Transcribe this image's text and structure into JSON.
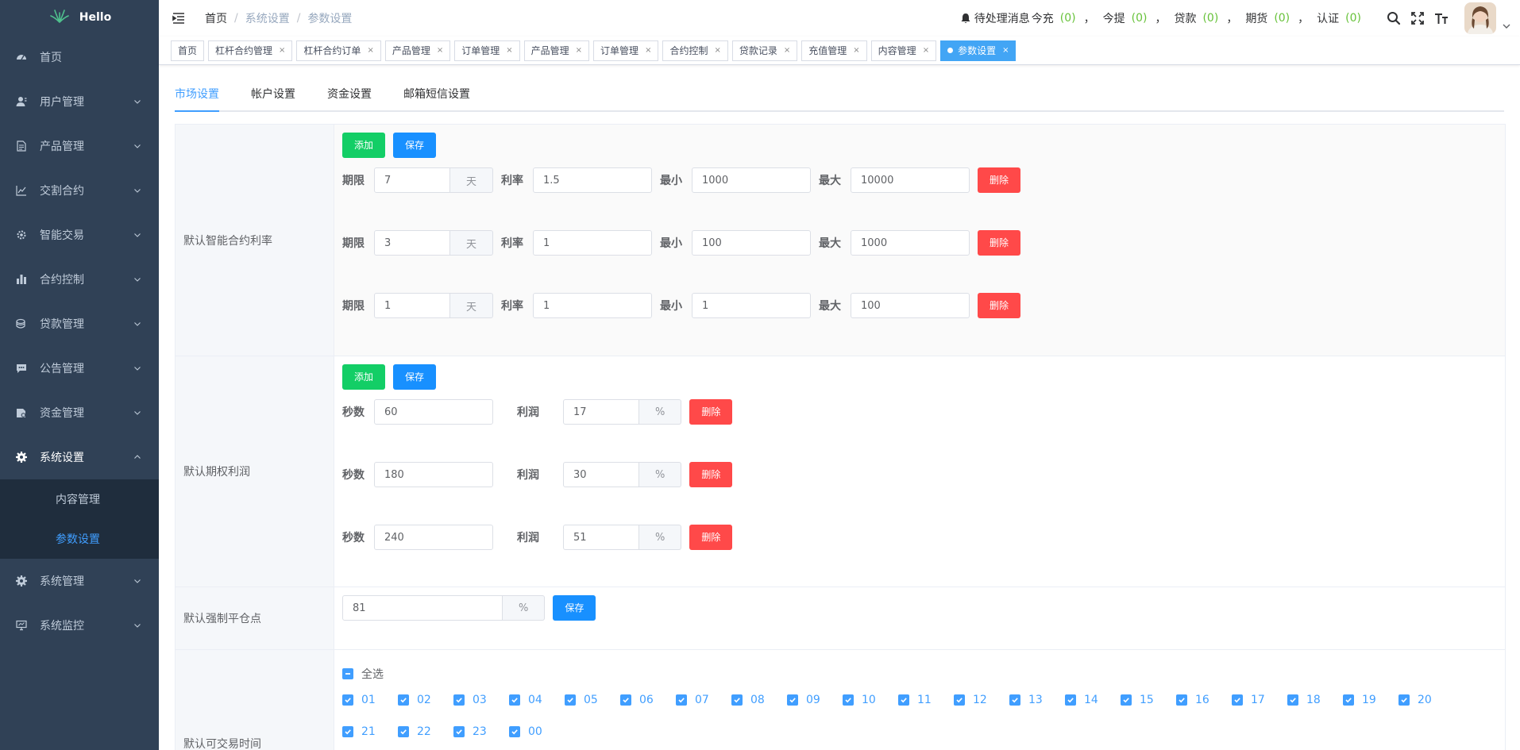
{
  "app": {
    "name": "Hello"
  },
  "sidebar": {
    "items": [
      {
        "label": "首页",
        "icon": "dashboard-icon",
        "has_arrow": false
      },
      {
        "label": "用户管理",
        "icon": "user-icon",
        "has_arrow": true
      },
      {
        "label": "产品管理",
        "icon": "document-icon",
        "has_arrow": true
      },
      {
        "label": "交割合约",
        "icon": "chart-line-icon",
        "has_arrow": true
      },
      {
        "label": "智能交易",
        "icon": "gear-small-icon",
        "has_arrow": true
      },
      {
        "label": "合约控制",
        "icon": "bar-chart-icon",
        "has_arrow": true
      },
      {
        "label": "贷款管理",
        "icon": "money-icon",
        "has_arrow": true
      },
      {
        "label": "公告管理",
        "icon": "message-icon",
        "has_arrow": true
      },
      {
        "label": "资金管理",
        "icon": "wallet-icon",
        "has_arrow": true
      },
      {
        "label": "系统设置",
        "icon": "gear-icon",
        "has_arrow": true,
        "open": true
      },
      {
        "label": "系统管理",
        "icon": "gear-icon",
        "has_arrow": true
      },
      {
        "label": "系统监控",
        "icon": "monitor-icon",
        "has_arrow": true
      }
    ],
    "submenu": [
      {
        "label": "内容管理",
        "active": false
      },
      {
        "label": "参数设置",
        "active": true
      }
    ]
  },
  "header": {
    "breadcrumb": [
      "首页",
      "系统设置",
      "参数设置"
    ],
    "notice_label": "待处理消息",
    "notices": [
      {
        "label": "今充",
        "count": "(0)"
      },
      {
        "label": "今提",
        "count": "(0)"
      },
      {
        "label": "贷款",
        "count": "(0)"
      },
      {
        "label": "期货",
        "count": "(0)"
      },
      {
        "label": "认证",
        "count": "(0)"
      }
    ],
    "comma": "，"
  },
  "tags": [
    {
      "label": "首页",
      "closable": false,
      "active": false
    },
    {
      "label": "杠杆合约管理",
      "closable": true,
      "active": false
    },
    {
      "label": "杠杆合约订单",
      "closable": true,
      "active": false
    },
    {
      "label": "产品管理",
      "closable": true,
      "active": false
    },
    {
      "label": "订单管理",
      "closable": true,
      "active": false
    },
    {
      "label": "产品管理",
      "closable": true,
      "active": false
    },
    {
      "label": "订单管理",
      "closable": true,
      "active": false
    },
    {
      "label": "合约控制",
      "closable": true,
      "active": false
    },
    {
      "label": "贷款记录",
      "closable": true,
      "active": false
    },
    {
      "label": "充值管理",
      "closable": true,
      "active": false
    },
    {
      "label": "内容管理",
      "closable": true,
      "active": false
    },
    {
      "label": "参数设置",
      "closable": true,
      "active": true
    }
  ],
  "tag_close": "×",
  "tabs": [
    "市场设置",
    "帐户设置",
    "资金设置",
    "邮箱短信设置"
  ],
  "buttons": {
    "add": "添加",
    "save": "保存",
    "delete": "删除"
  },
  "contract_rate": {
    "label": "默认智能合约利率",
    "field_labels": {
      "period": "期限",
      "period_unit": "天",
      "rate": "利率",
      "min": "最小",
      "max": "最大"
    },
    "rows": [
      {
        "period": "7",
        "rate": "1.5",
        "min": "1000",
        "max": "10000"
      },
      {
        "period": "3",
        "rate": "1",
        "min": "100",
        "max": "1000"
      },
      {
        "period": "1",
        "rate": "1",
        "min": "1",
        "max": "100"
      }
    ]
  },
  "option_profit": {
    "label": "默认期权利润",
    "field_labels": {
      "seconds": "秒数",
      "profit": "利润",
      "unit": "%"
    },
    "rows": [
      {
        "seconds": "60",
        "profit": "17"
      },
      {
        "seconds": "180",
        "profit": "30"
      },
      {
        "seconds": "240",
        "profit": "51"
      }
    ]
  },
  "liquidation": {
    "label": "默认强制平仓点",
    "value": "81",
    "unit": "%"
  },
  "trading_time": {
    "label": "默认可交易时间",
    "select_all": "全选",
    "hours": [
      "01",
      "02",
      "03",
      "04",
      "05",
      "06",
      "07",
      "08",
      "09",
      "10",
      "11",
      "12",
      "13",
      "14",
      "15",
      "16",
      "17",
      "18",
      "19",
      "20",
      "21",
      "22",
      "23",
      "00"
    ]
  },
  "colors": {
    "sidebar": "#304156",
    "accent": "#409eff",
    "success": "#13ce66",
    "danger": "#ff4949",
    "count": "#67c23a"
  }
}
